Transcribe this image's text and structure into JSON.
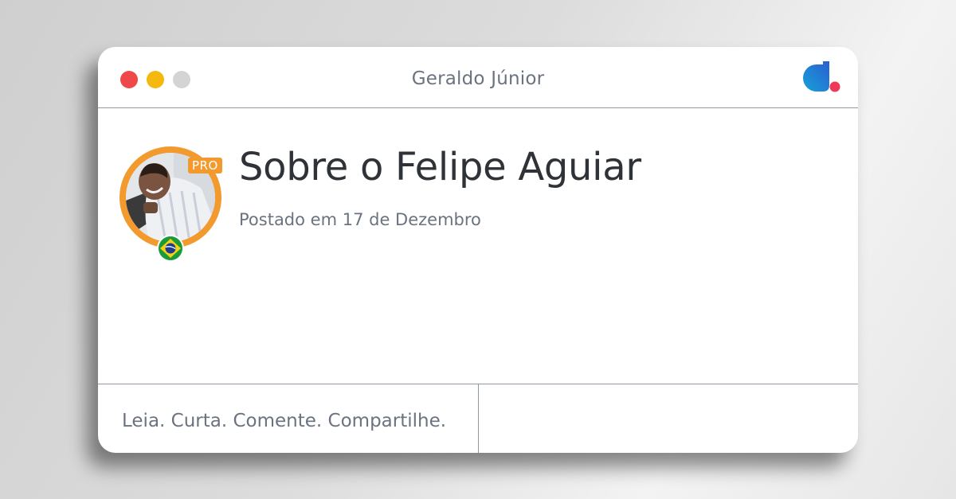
{
  "window": {
    "title": "Geraldo Júnior",
    "controls": [
      "close",
      "minimize",
      "maximize"
    ]
  },
  "logo": {
    "icon": "brand-logo-icon",
    "colors": {
      "primary": "#1a8fd6",
      "accent": "#ee3a57"
    }
  },
  "author": {
    "badge": "PRO",
    "flag": "brazil-flag-icon",
    "ring_color": "#f39a2e"
  },
  "post": {
    "title": "Sobre o Felipe Aguiar",
    "date": "Postado em 17 de Dezembro"
  },
  "footer": {
    "tagline": "Leia. Curta. Comente. Compartilhe."
  }
}
